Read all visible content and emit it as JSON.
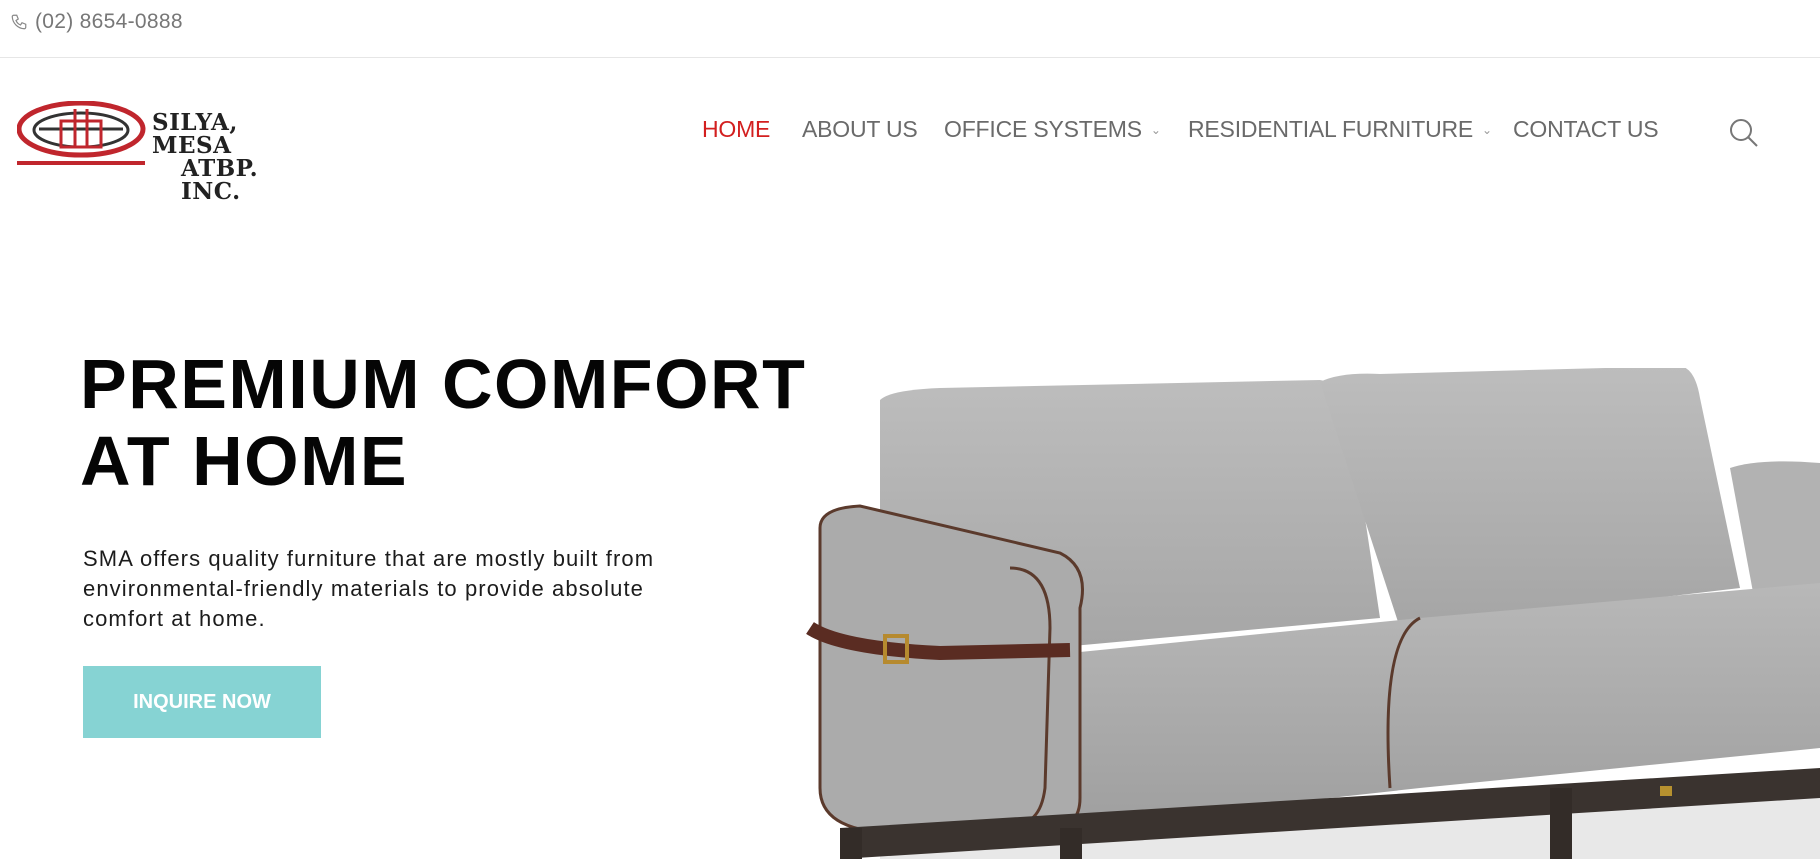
{
  "topbar": {
    "phone": "(02) 8654-0888",
    "phone_icon": "phone-icon"
  },
  "logo": {
    "line1": "SILYA, MESA",
    "line2": "ATBP. INC."
  },
  "nav": {
    "items": [
      {
        "label": "HOME",
        "active": true
      },
      {
        "label": "ABOUT US"
      },
      {
        "label": "OFFICE SYSTEMS",
        "dropdown": true
      },
      {
        "label": "RESIDENTIAL FURNITURE",
        "dropdown": true
      },
      {
        "label": "CONTACT US"
      }
    ],
    "search_icon": "search-icon"
  },
  "hero": {
    "title_line1": "PREMIUM COMFORT",
    "title_line2": "AT HOME",
    "description_line1": "SMA offers quality furniture that are mostly built from",
    "description_line2": "environmental-friendly materials to provide absolute",
    "description_line3": "comfort at home.",
    "cta_label": "INQUIRE NOW"
  },
  "colors": {
    "accent": "#d31f1f",
    "cta": "#86d3d3",
    "nav_text": "#6a6a6a"
  }
}
